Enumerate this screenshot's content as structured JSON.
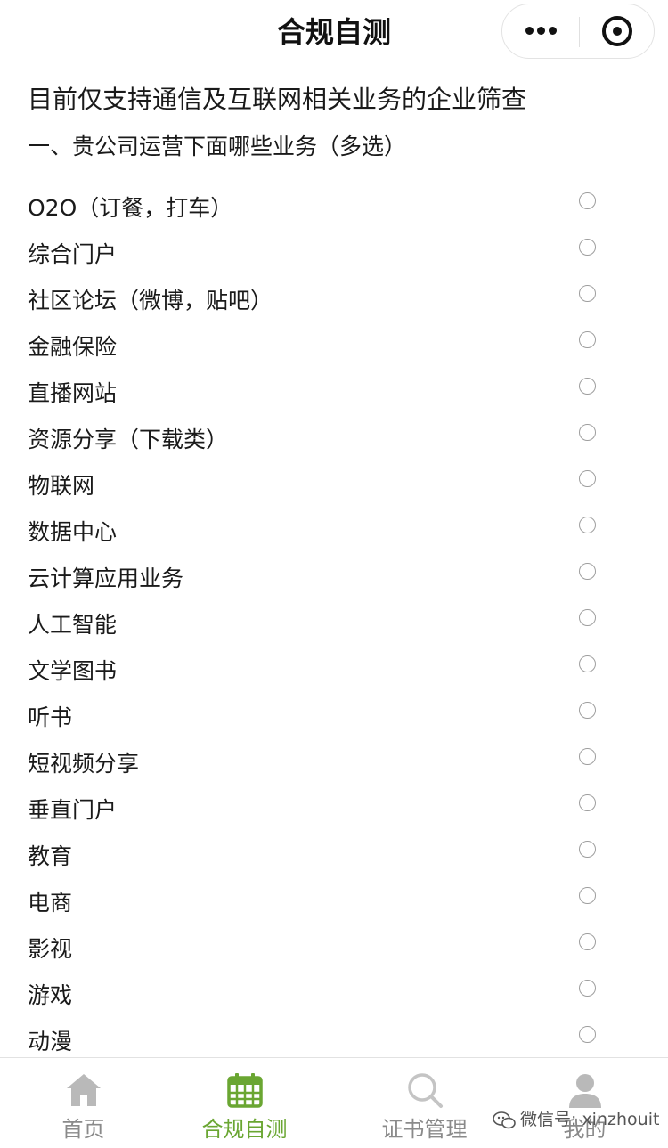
{
  "navbar": {
    "title": "合规自测"
  },
  "intro": "目前仅支持通信及互联网相关业务的企业筛查",
  "question": "一、贵公司运营下面哪些业务（多选）",
  "options": [
    {
      "label": "O2O（订餐，打车）",
      "checked": false
    },
    {
      "label": "综合门户",
      "checked": false
    },
    {
      "label": "社区论坛（微博，贴吧）",
      "checked": false
    },
    {
      "label": "金融保险",
      "checked": false
    },
    {
      "label": "直播网站",
      "checked": false
    },
    {
      "label": "资源分享（下载类）",
      "checked": false
    },
    {
      "label": "物联网",
      "checked": false
    },
    {
      "label": "数据中心",
      "checked": false
    },
    {
      "label": "云计算应用业务",
      "checked": false
    },
    {
      "label": "人工智能",
      "checked": false
    },
    {
      "label": "文学图书",
      "checked": false
    },
    {
      "label": "听书",
      "checked": false
    },
    {
      "label": "短视频分享",
      "checked": false
    },
    {
      "label": "垂直门户",
      "checked": false
    },
    {
      "label": "教育",
      "checked": false
    },
    {
      "label": "电商",
      "checked": false
    },
    {
      "label": "影视",
      "checked": false
    },
    {
      "label": "游戏",
      "checked": false
    },
    {
      "label": "动漫",
      "checked": false
    }
  ],
  "tabbar": {
    "active_color": "#6aa632",
    "inactive_color": "#8a8a8a",
    "tabs": [
      {
        "label": "首页",
        "icon": "home-icon",
        "active": false
      },
      {
        "label": "合规自测",
        "icon": "calendar-icon",
        "active": true
      },
      {
        "label": "证书管理",
        "icon": "search-icon",
        "active": false
      },
      {
        "label": "我的",
        "icon": "user-icon",
        "active": false
      }
    ]
  },
  "watermark": {
    "text": "微信号: xinzhouit"
  }
}
